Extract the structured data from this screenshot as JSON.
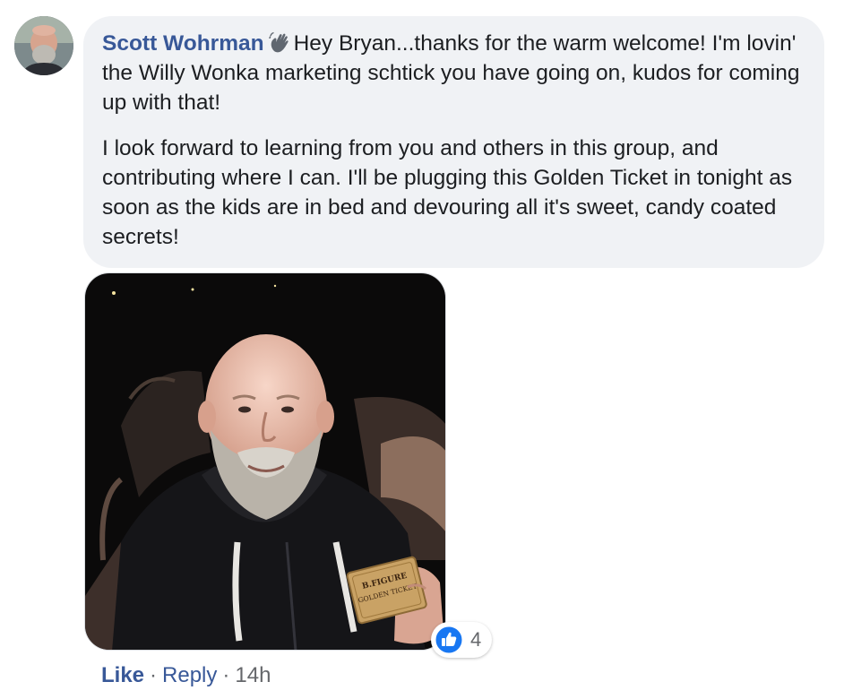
{
  "comment": {
    "author": "Scott Wohrman",
    "badge_icon": "waving-hand-icon",
    "paragraphs": [
      "Hey Bryan...thanks for the warm welcome! I'm lovin' the Willy Wonka marketing schtick you have going on, kudos for coming up with that!",
      "I look forward to learning from you and others in this group, and contributing where I can. I'll be plugging this Golden Ticket in tonight as soon as the kids are in bed and devouring all it's sweet, candy coated secrets!"
    ],
    "photo": {
      "ticket_brand": "B.FIGURE",
      "ticket_title": "GOLDEN TICKET"
    },
    "reactions": {
      "icon": "thumbs-up-icon",
      "count": "4",
      "color": "#1877f2"
    },
    "actions": {
      "like_label": "Like",
      "reply_label": "Reply",
      "separator": "·",
      "timestamp": "14h"
    }
  },
  "colors": {
    "link": "#385898",
    "bubble": "#f0f2f5",
    "muted": "#65676b"
  }
}
